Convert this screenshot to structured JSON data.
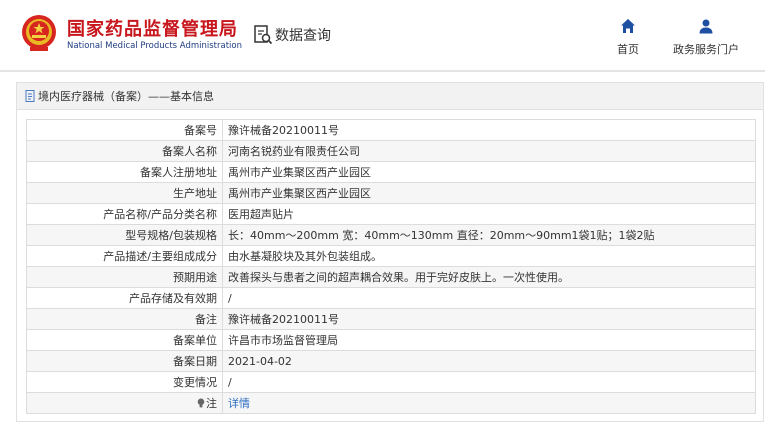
{
  "header": {
    "brand_cn": "国家药品监督管理局",
    "brand_en": "National Medical Products Administration",
    "query_label": "数据查询",
    "nav": {
      "home_label": "首页",
      "portal_label": "政务服务门户"
    }
  },
  "panel": {
    "title": "境内医疗器械（备案）——基本信息"
  },
  "rows": [
    {
      "label": "备案号",
      "value": "豫许械备20210011号"
    },
    {
      "label": "备案人名称",
      "value": "河南名锐药业有限责任公司"
    },
    {
      "label": "备案人注册地址",
      "value": "禹州市产业集聚区西产业园区"
    },
    {
      "label": "生产地址",
      "value": "禹州市产业集聚区西产业园区"
    },
    {
      "label": "产品名称/产品分类名称",
      "value": "医用超声贴片"
    },
    {
      "label": "型号规格/包装规格",
      "value": "长：40mm～200mm 宽：40mm～130mm 直径：20mm～90mm1袋1贴；1袋2贴"
    },
    {
      "label": "产品描述/主要组成成分",
      "value": "由水基凝胶块及其外包装组成。"
    },
    {
      "label": "预期用途",
      "value": "改善探头与患者之间的超声耦合效果。用于完好皮肤上。一次性使用。"
    },
    {
      "label": "产品存储及有效期",
      "value": "/"
    },
    {
      "label": "备注",
      "value": "豫许械备20210011号"
    },
    {
      "label": "备案单位",
      "value": "许昌市市场监督管理局"
    },
    {
      "label": "备案日期",
      "value": "2021-04-02"
    },
    {
      "label": "变更情况",
      "value": "/"
    },
    {
      "label": "注",
      "value": "详情"
    }
  ],
  "colors": {
    "brand_red": "#c8161d",
    "brand_blue": "#1f3c80",
    "nav_icon_blue": "#1e4fa1",
    "link_blue": "#2b6dc2"
  },
  "icons": {
    "emblem": "national-emblem-icon",
    "query": "data-query-icon",
    "home": "home-icon",
    "portal": "user-icon",
    "title": "document-icon",
    "note": "lightbulb-icon"
  }
}
